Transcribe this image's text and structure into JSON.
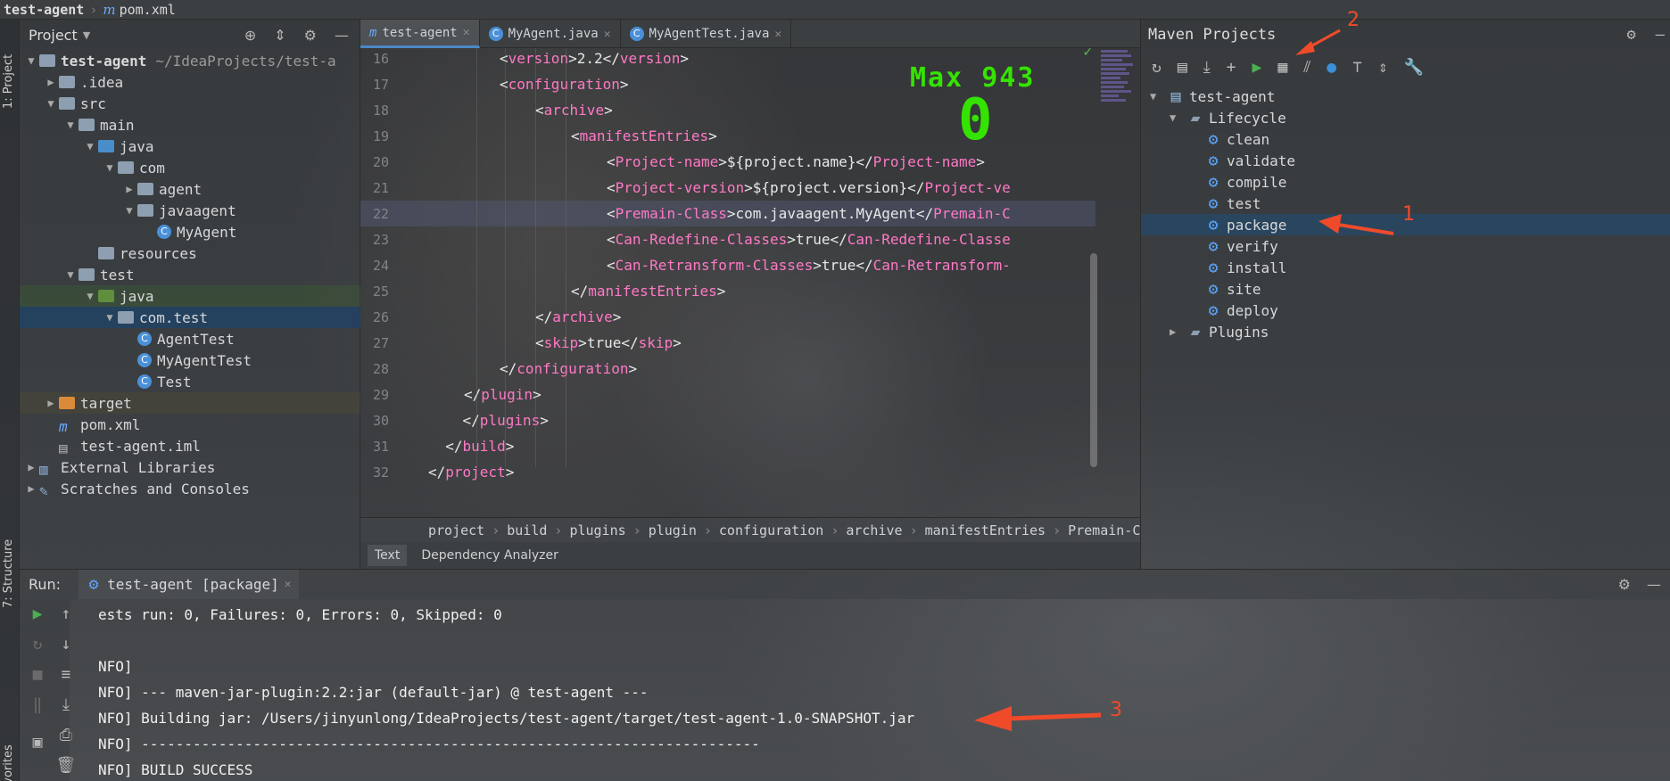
{
  "topbar": {
    "project": "test-agent",
    "file": "pom.xml"
  },
  "left_stripe": {
    "project_tab": "1: Project",
    "structure_tab": "7: Structure",
    "favorites_tab": "Favorites"
  },
  "project_panel": {
    "title": "Project",
    "tree": [
      {
        "label": "test-agent",
        "extra": "~/IdeaProjects/test-a",
        "depth": 0,
        "arrow": "open",
        "icon": "folder"
      },
      {
        "label": ".idea",
        "depth": 1,
        "arrow": "closed",
        "icon": "folder"
      },
      {
        "label": "src",
        "depth": 1,
        "arrow": "open",
        "icon": "folder"
      },
      {
        "label": "main",
        "depth": 2,
        "arrow": "open",
        "icon": "folder"
      },
      {
        "label": "java",
        "depth": 3,
        "arrow": "open",
        "icon": "folder-blue"
      },
      {
        "label": "com",
        "depth": 4,
        "arrow": "open",
        "icon": "package"
      },
      {
        "label": "agent",
        "depth": 5,
        "arrow": "closed",
        "icon": "package"
      },
      {
        "label": "javaagent",
        "depth": 5,
        "arrow": "open",
        "icon": "package"
      },
      {
        "label": "MyAgent",
        "depth": 6,
        "arrow": "none",
        "icon": "class"
      },
      {
        "label": "resources",
        "depth": 3,
        "arrow": "none",
        "icon": "folder"
      },
      {
        "label": "test",
        "depth": 2,
        "arrow": "open",
        "icon": "folder"
      },
      {
        "label": "java",
        "depth": 3,
        "arrow": "open",
        "icon": "folder-green"
      },
      {
        "label": "com.test",
        "depth": 4,
        "arrow": "open",
        "icon": "package"
      },
      {
        "label": "AgentTest",
        "depth": 5,
        "arrow": "none",
        "icon": "class"
      },
      {
        "label": "MyAgentTest",
        "depth": 5,
        "arrow": "none",
        "icon": "class"
      },
      {
        "label": "Test",
        "depth": 5,
        "arrow": "none",
        "icon": "class"
      },
      {
        "label": "target",
        "depth": 1,
        "arrow": "closed",
        "icon": "folder-orange"
      },
      {
        "label": "pom.xml",
        "depth": 1,
        "arrow": "none",
        "icon": "maven"
      },
      {
        "label": "test-agent.iml",
        "depth": 1,
        "arrow": "none",
        "icon": "iml"
      },
      {
        "label": "External Libraries",
        "depth": 0,
        "arrow": "closed",
        "icon": "libs"
      },
      {
        "label": "Scratches and Consoles",
        "depth": 0,
        "arrow": "closed",
        "icon": "scratch"
      }
    ],
    "selected_index": 12
  },
  "editor_tabs": [
    {
      "label": "test-agent",
      "icon": "maven-icon",
      "active": true
    },
    {
      "label": "MyAgent.java",
      "icon": "class-icon",
      "active": false
    },
    {
      "label": "MyAgentTest.java",
      "icon": "class-icon",
      "active": false
    }
  ],
  "editor": {
    "lines": [
      {
        "n": "16",
        "indent": 8,
        "parts": [
          [
            "t",
            "<"
          ],
          [
            "n",
            "version"
          ],
          [
            "t",
            ">"
          ],
          [
            "b",
            "2.2"
          ],
          [
            "t",
            "</"
          ],
          [
            "n",
            "version"
          ],
          [
            "t",
            ">"
          ]
        ]
      },
      {
        "n": "17",
        "indent": 8,
        "parts": [
          [
            "t",
            "<"
          ],
          [
            "n",
            "configuration"
          ],
          [
            "t",
            ">"
          ]
        ]
      },
      {
        "n": "18",
        "indent": 12,
        "parts": [
          [
            "t",
            "<"
          ],
          [
            "n",
            "archive"
          ],
          [
            "t",
            ">"
          ]
        ]
      },
      {
        "n": "19",
        "indent": 16,
        "parts": [
          [
            "t",
            "<"
          ],
          [
            "n",
            "manifestEntries"
          ],
          [
            "t",
            ">"
          ]
        ]
      },
      {
        "n": "20",
        "indent": 20,
        "parts": [
          [
            "t",
            "<"
          ],
          [
            "n",
            "Project-name"
          ],
          [
            "t",
            ">"
          ],
          [
            "b",
            "${project.name}"
          ],
          [
            "t",
            "</"
          ],
          [
            "n",
            "Project-name"
          ],
          [
            "t",
            ">"
          ]
        ]
      },
      {
        "n": "21",
        "indent": 20,
        "parts": [
          [
            "t",
            "<"
          ],
          [
            "n",
            "Project-version"
          ],
          [
            "t",
            ">"
          ],
          [
            "b",
            "${project.version}"
          ],
          [
            "t",
            "</"
          ],
          [
            "n",
            "Project-ve"
          ]
        ]
      },
      {
        "n": "22",
        "indent": 20,
        "parts": [
          [
            "t",
            "<"
          ],
          [
            "n",
            "Premain-Class"
          ],
          [
            "t",
            ">"
          ],
          [
            "b",
            "com.javaagent.MyAgent"
          ],
          [
            "t",
            "</"
          ],
          [
            "n",
            "Premain-C"
          ]
        ]
      },
      {
        "n": "23",
        "indent": 20,
        "parts": [
          [
            "t",
            "<"
          ],
          [
            "n",
            "Can-Redefine-Classes"
          ],
          [
            "t",
            ">"
          ],
          [
            "b",
            "true"
          ],
          [
            "t",
            "</"
          ],
          [
            "n",
            "Can-Redefine-Classe"
          ]
        ]
      },
      {
        "n": "24",
        "indent": 20,
        "parts": [
          [
            "t",
            "<"
          ],
          [
            "n",
            "Can-Retransform-Classes"
          ],
          [
            "t",
            ">"
          ],
          [
            "b",
            "true"
          ],
          [
            "t",
            "</"
          ],
          [
            "n",
            "Can-Retransform-"
          ]
        ]
      },
      {
        "n": "25",
        "indent": 16,
        "parts": [
          [
            "t",
            "</"
          ],
          [
            "n",
            "manifestEntries"
          ],
          [
            "t",
            ">"
          ]
        ]
      },
      {
        "n": "26",
        "indent": 12,
        "parts": [
          [
            "t",
            "</"
          ],
          [
            "n",
            "archive"
          ],
          [
            "t",
            ">"
          ]
        ]
      },
      {
        "n": "27",
        "indent": 12,
        "parts": [
          [
            "t",
            "<"
          ],
          [
            "n",
            "skip"
          ],
          [
            "t",
            ">"
          ],
          [
            "b",
            "true"
          ],
          [
            "t",
            "</"
          ],
          [
            "n",
            "skip"
          ],
          [
            "t",
            ">"
          ]
        ]
      },
      {
        "n": "28",
        "indent": 8,
        "parts": [
          [
            "t",
            "</"
          ],
          [
            "n",
            "configuration"
          ],
          [
            "t",
            ">"
          ]
        ]
      },
      {
        "n": "29",
        "indent": 4,
        "parts": [
          [
            "t",
            "</"
          ],
          [
            "n",
            "plugin"
          ],
          [
            "t",
            ">"
          ]
        ]
      },
      {
        "n": "30",
        "indent": 0,
        "parts": [
          [
            "t",
            "    </"
          ],
          [
            "n",
            "plugins"
          ],
          [
            "t",
            ">"
          ]
        ]
      },
      {
        "n": "31",
        "indent": 0,
        "parts": [
          [
            "t",
            "  </"
          ],
          [
            "n",
            "build"
          ],
          [
            "t",
            ">"
          ]
        ]
      },
      {
        "n": "32",
        "indent": 0,
        "parts": [
          [
            "t",
            "</"
          ],
          [
            "n",
            "project"
          ],
          [
            "t",
            ">"
          ]
        ]
      }
    ],
    "current_line": "22",
    "overlay_max": "Max 943",
    "overlay_value": "0"
  },
  "editor_breadcrumb": [
    "project",
    "build",
    "plugins",
    "plugin",
    "configuration",
    "archive",
    "manifestEntries",
    "Premain-Cl"
  ],
  "editor_bottom_tabs": [
    {
      "label": "Text",
      "active": true
    },
    {
      "label": "Dependency Analyzer",
      "active": false
    }
  ],
  "maven": {
    "title": "Maven Projects",
    "root": "test-agent",
    "lifecycle_label": "Lifecycle",
    "phases": [
      "clean",
      "validate",
      "compile",
      "test",
      "package",
      "verify",
      "install",
      "site",
      "deploy"
    ],
    "selected_phase": "package",
    "plugins_label": "Plugins"
  },
  "run": {
    "label": "Run:",
    "tab_label": "test-agent [package]",
    "console": [
      "ests run: 0, Failures: 0, Errors: 0, Skipped: 0",
      "",
      "NFO]",
      "NFO] --- maven-jar-plugin:2.2:jar (default-jar) @ test-agent ---",
      "NFO] Building jar: /Users/jinyunlong/IdeaProjects/test-agent/target/test-agent-1.0-SNAPSHOT.jar",
      "NFO] ------------------------------------------------------------------------",
      "NFO] BUILD SUCCESS"
    ]
  },
  "annotations": {
    "a1": "1",
    "a2": "2",
    "a3": "3",
    "color": "#ef4b2a"
  },
  "colors": {
    "accent": "#4a88c7",
    "tag_name": "#ff79c6",
    "overlay_green": "#35e300",
    "maven_gear": "#5aa6ff"
  }
}
